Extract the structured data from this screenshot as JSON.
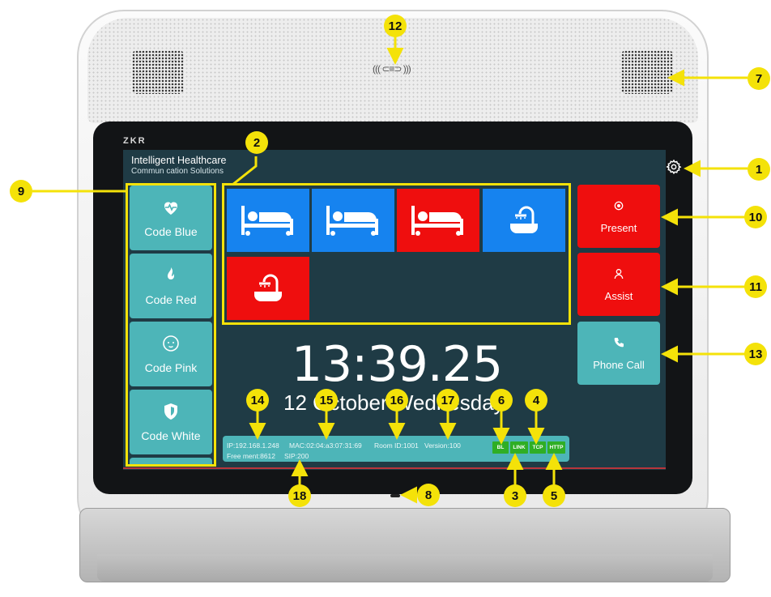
{
  "device": {
    "brand": "ZKR",
    "header_title": "Intelligent Healthcare",
    "header_subtitle": "Commun cation Solutions"
  },
  "codes": [
    {
      "label": "Code Blue",
      "icon": "heart-pulse-icon"
    },
    {
      "label": "Code Red",
      "icon": "flame-icon"
    },
    {
      "label": "Code Pink",
      "icon": "baby-face-icon"
    },
    {
      "label": "Code White",
      "icon": "shield-icon"
    }
  ],
  "call_tiles": [
    {
      "icon": "bed-icon",
      "color": "#1683ef"
    },
    {
      "icon": "bed-icon",
      "color": "#1683ef"
    },
    {
      "icon": "bed-icon",
      "color": "#ef0e0e"
    },
    {
      "icon": "shower-bath-icon",
      "color": "#1683ef"
    },
    {
      "icon": "shower-bath-icon",
      "color": "#ef0e0e"
    }
  ],
  "actions": {
    "present": "Present",
    "assist": "Assist",
    "phone_call": "Phone Call"
  },
  "clock": {
    "time": "13:39.25",
    "date": "12 October Wednesday"
  },
  "status": {
    "ip": "IP:192.168.1.248",
    "mac": "MAC:02:04:a3:07:31:69",
    "room": "Room ID:1001",
    "version": "Version:100",
    "free": "Free ment:8612",
    "sip": "SIP:200",
    "indicators": [
      "BL",
      "LINK",
      "TCP",
      "HTTP"
    ]
  },
  "callouts": [
    "1",
    "2",
    "3",
    "4",
    "5",
    "6",
    "7",
    "8",
    "9",
    "10",
    "11",
    "12",
    "13",
    "14",
    "15",
    "16",
    "17",
    "18"
  ],
  "colors": {
    "teal_button": "#4db5b8",
    "screen_bg": "#1f3b45",
    "tile_blue": "#1683ef",
    "alert_red": "#ef0e0e",
    "indicator_green": "#2fae25",
    "callout_yellow": "#f4e209"
  }
}
